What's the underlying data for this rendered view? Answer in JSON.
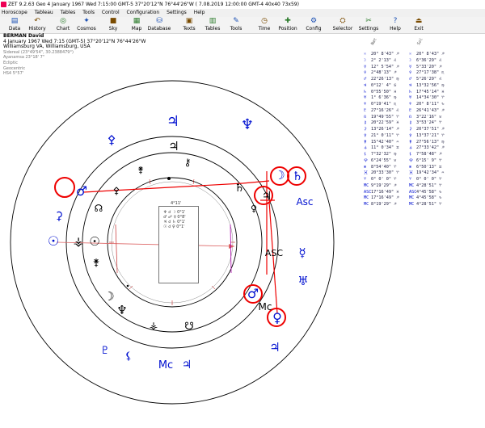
{
  "window": {
    "title": "ZET 9.2.63 Geo   4 January 1967  Wed   7:15:00 GMT-5 37°20'12\"N  76°44'26\"W  ( 7.08.2019  12:00:00 GMT-4 40x40 73x59)"
  },
  "menu": [
    "Horoscope",
    "Tableau",
    "Tables",
    "Tools",
    "Control",
    "Configuration",
    "Settings",
    "Help"
  ],
  "toolbar": [
    {
      "label": "Data",
      "icon": "data-icon"
    },
    {
      "label": "History",
      "icon": "history-icon"
    },
    {
      "label": "Chart",
      "icon": "chart-icon"
    },
    {
      "label": "Cosmos",
      "icon": "cosmos-icon"
    },
    {
      "label": "Sky",
      "icon": "sky-icon"
    },
    {
      "label": "Map",
      "icon": "map-icon"
    },
    {
      "label": "Database",
      "icon": "database-icon"
    },
    {
      "label": "Texts",
      "icon": "texts-icon"
    },
    {
      "label": "Tables",
      "icon": "tables-icon"
    },
    {
      "label": "Tools",
      "icon": "tools-icon"
    },
    {
      "label": "Time",
      "icon": "time-icon"
    },
    {
      "label": "Position",
      "icon": "position-icon"
    },
    {
      "label": "Config",
      "icon": "config-icon"
    },
    {
      "label": "Selector",
      "icon": "selector-icon"
    },
    {
      "label": "Settings",
      "icon": "settings-icon"
    },
    {
      "label": "Help",
      "icon": "help-icon"
    },
    {
      "label": "Exit",
      "icon": "exit-icon"
    }
  ],
  "header": {
    "name": "BERMAN David",
    "line1": "4 January 1967  Wed   7:15 (GMT-5) 37°20'12\"N  76°44'26\"W",
    "line2": "Williamsburg VA, Williamsburg, USA",
    "line3": "Sidereal (23°49'54\", 30.2388479°)",
    "line4": "Ayanamsa 23°18' 7\"",
    "line5": "Ecliptic",
    "line6": "Geocentric",
    "line7": "HS4  5°57'"
  },
  "inset": {
    "title": "4°11'",
    "lines": [
      "♆ ☌ ☽  0°1'",
      "♂ ☍ ☿  0°8'",
      "♃ ☌ ♄  0°1'",
      "☉ ☌ ♀  0°1'"
    ]
  },
  "table": {
    "headers": [
      "Nat",
      "Sol"
    ],
    "rows": [
      [
        "☉",
        "20° 8'43\" ♐",
        "☉",
        "20° 8'43\" ♐"
      ],
      [
        "☽",
        "2° 2'13\" ♌",
        "☽",
        "6°36'29\" ♌"
      ],
      [
        "☿",
        "12° 5'54\" ♐",
        "☿",
        "5°33'20\" ♐"
      ],
      [
        "♀",
        "2°48'13\" ♐",
        "♀",
        "27°17'38\" ♏"
      ],
      [
        "♂",
        "22°26'13\" ♍",
        "♂",
        "5°26'29\" ♌"
      ],
      [
        "♃",
        "0°12' 4\" ♋",
        "♃",
        "13°32'56\" ♍"
      ],
      [
        "♄",
        "0°55'50\" ♓",
        "♄",
        "17°45'14\" ♓"
      ],
      [
        "♅",
        "1° 6'36\" ♍",
        "♅",
        "14°34'30\" ♈"
      ],
      [
        "♆",
        "0°19'41\" ♏",
        "♆",
        "20° 8'11\" ♑"
      ],
      [
        "♇",
        "27°16'26\" ♌",
        "♇",
        "26°41'43\" ♐"
      ],
      [
        "☊",
        "19°49'55\" ♈",
        "☊",
        "3°22'16\" ♉"
      ],
      [
        "⚷",
        "20°22'59\" ♓",
        "⚷",
        "3°53'24\" ♈"
      ],
      [
        "⚳",
        "13°26'14\" ♐",
        "⚳",
        "20°37'51\" ♐"
      ],
      [
        "⚴",
        "21° 0'11\" ♈",
        "⚴",
        "13°37'21\" ♈"
      ],
      [
        "⚵",
        "15°42'40\" ♒",
        "⚵",
        "27°56'13\" ♍"
      ],
      [
        "⚶",
        "11° 0'34\" ♊",
        "⚶",
        "27°33'42\" ♐"
      ],
      [
        "⚸",
        "7°32'32\" ♍",
        "⚸",
        "7°58'48\" ♐"
      ],
      [
        "⯓",
        "6°24'55\" ♉",
        "⯓",
        "6°15' 9\" ♈"
      ],
      [
        "⊗",
        "8°54'40\" ♈",
        "⊗",
        "6°50'13\" ♊"
      ],
      [
        "⯘",
        "20°33'30\" ♈",
        "⯘",
        "19°42'34\" ♒"
      ],
      [
        "♈",
        "0° 0' 0\" ♈",
        "♈",
        "0° 0' 0\" ♈"
      ],
      [
        "MC",
        "9°19'29\" ♐",
        "MC",
        "4°28'51\" ♈"
      ],
      [
        "ASC",
        "17°16'49\" ♓",
        "ASC",
        "4°45'58\" ♑"
      ],
      [
        "MC",
        "17°16'49\" ♐",
        "MC",
        "4°45'58\" ♑"
      ],
      [
        "MC",
        "8°19'29\" ♐",
        "MC",
        "4°28'51\" ♈"
      ]
    ]
  },
  "wheel": {
    "outer_glyphs": [
      {
        "g": "♃",
        "label": "jupiter"
      },
      {
        "g": "♆",
        "label": "neptune"
      },
      {
        "g": "⚴",
        "label": "pallas"
      },
      {
        "g": "⚳",
        "label": "ceres"
      },
      {
        "g": "☉",
        "label": "sun"
      },
      {
        "g": "♂",
        "label": "mars"
      },
      {
        "g": "☿",
        "label": "mercury"
      },
      {
        "g": "♅",
        "label": "uranus"
      },
      {
        "g": "♀",
        "label": "venus"
      },
      {
        "g": "Mc",
        "label": "mc"
      },
      {
        "g": "♃",
        "label": "jupiter"
      },
      {
        "g": "♇",
        "label": "pluto"
      }
    ],
    "asc_label": "Asc",
    "asc_label2": "ASC",
    "mc_label": "Mc",
    "mc_label2": "Mc",
    "colors": {
      "blue": "#0010d0",
      "red": "#e00000",
      "black": "#000000"
    }
  }
}
